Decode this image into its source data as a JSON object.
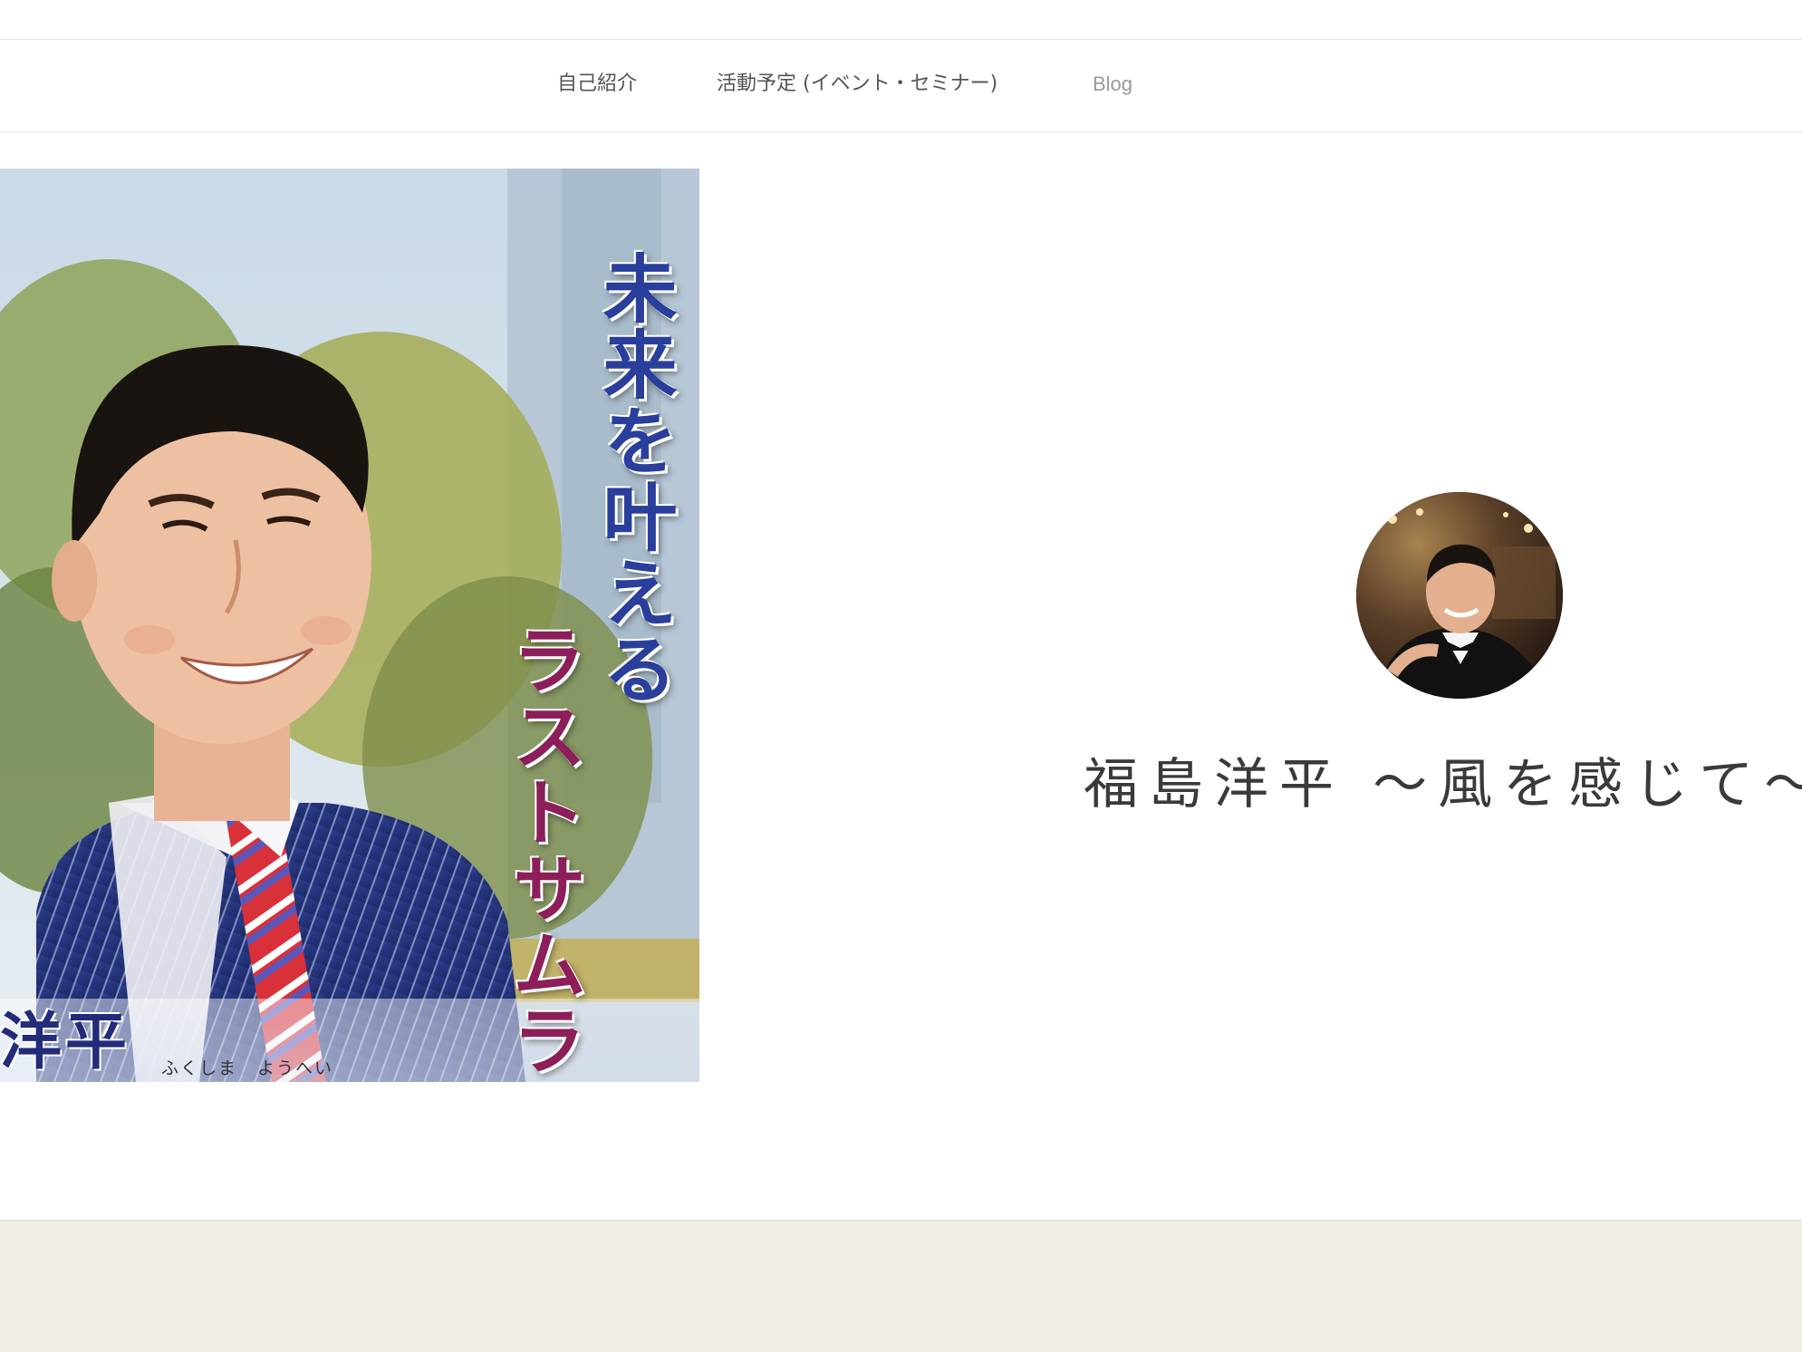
{
  "nav": {
    "items": [
      {
        "label": "自己紹介"
      },
      {
        "label": "活動予定 (イベント・セミナー)"
      },
      {
        "label": "Blog"
      }
    ]
  },
  "banner": {
    "tagline_line1": "未来を叶える",
    "tagline_line2": "ラストサムライ",
    "name": "洋平",
    "reading": "ふくしま ようへい"
  },
  "profile": {
    "avatar_icon": "profile-photo",
    "site_title": "福島洋平 ～風を感じて～"
  },
  "colors": {
    "accent_blue": "#2a3f9c",
    "accent_red": "#8c1f5a",
    "footer_bg": "#f1efe5",
    "nav_text": "#555555"
  }
}
